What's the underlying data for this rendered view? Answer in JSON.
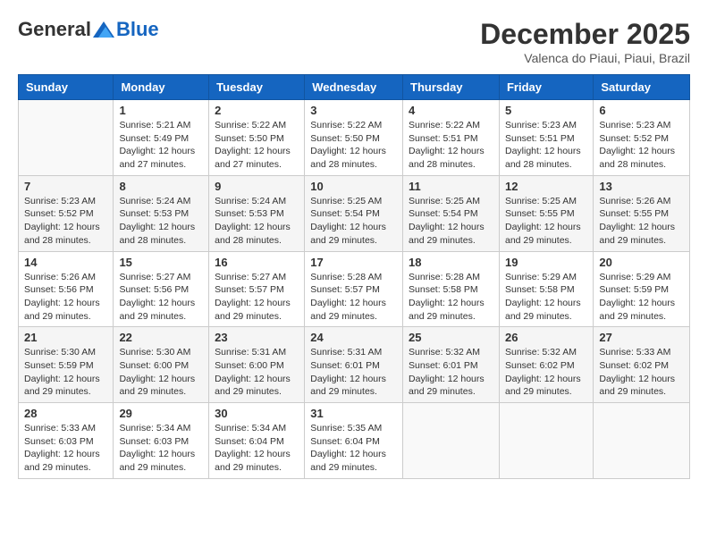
{
  "header": {
    "logo_general": "General",
    "logo_blue": "Blue",
    "month_title": "December 2025",
    "location": "Valenca do Piaui, Piaui, Brazil"
  },
  "weekdays": [
    "Sunday",
    "Monday",
    "Tuesday",
    "Wednesday",
    "Thursday",
    "Friday",
    "Saturday"
  ],
  "weeks": [
    [
      {
        "day": "",
        "info": ""
      },
      {
        "day": "1",
        "info": "Sunrise: 5:21 AM\nSunset: 5:49 PM\nDaylight: 12 hours\nand 27 minutes."
      },
      {
        "day": "2",
        "info": "Sunrise: 5:22 AM\nSunset: 5:50 PM\nDaylight: 12 hours\nand 27 minutes."
      },
      {
        "day": "3",
        "info": "Sunrise: 5:22 AM\nSunset: 5:50 PM\nDaylight: 12 hours\nand 28 minutes."
      },
      {
        "day": "4",
        "info": "Sunrise: 5:22 AM\nSunset: 5:51 PM\nDaylight: 12 hours\nand 28 minutes."
      },
      {
        "day": "5",
        "info": "Sunrise: 5:23 AM\nSunset: 5:51 PM\nDaylight: 12 hours\nand 28 minutes."
      },
      {
        "day": "6",
        "info": "Sunrise: 5:23 AM\nSunset: 5:52 PM\nDaylight: 12 hours\nand 28 minutes."
      }
    ],
    [
      {
        "day": "7",
        "info": "Sunrise: 5:23 AM\nSunset: 5:52 PM\nDaylight: 12 hours\nand 28 minutes."
      },
      {
        "day": "8",
        "info": "Sunrise: 5:24 AM\nSunset: 5:53 PM\nDaylight: 12 hours\nand 28 minutes."
      },
      {
        "day": "9",
        "info": "Sunrise: 5:24 AM\nSunset: 5:53 PM\nDaylight: 12 hours\nand 28 minutes."
      },
      {
        "day": "10",
        "info": "Sunrise: 5:25 AM\nSunset: 5:54 PM\nDaylight: 12 hours\nand 29 minutes."
      },
      {
        "day": "11",
        "info": "Sunrise: 5:25 AM\nSunset: 5:54 PM\nDaylight: 12 hours\nand 29 minutes."
      },
      {
        "day": "12",
        "info": "Sunrise: 5:25 AM\nSunset: 5:55 PM\nDaylight: 12 hours\nand 29 minutes."
      },
      {
        "day": "13",
        "info": "Sunrise: 5:26 AM\nSunset: 5:55 PM\nDaylight: 12 hours\nand 29 minutes."
      }
    ],
    [
      {
        "day": "14",
        "info": "Sunrise: 5:26 AM\nSunset: 5:56 PM\nDaylight: 12 hours\nand 29 minutes."
      },
      {
        "day": "15",
        "info": "Sunrise: 5:27 AM\nSunset: 5:56 PM\nDaylight: 12 hours\nand 29 minutes."
      },
      {
        "day": "16",
        "info": "Sunrise: 5:27 AM\nSunset: 5:57 PM\nDaylight: 12 hours\nand 29 minutes."
      },
      {
        "day": "17",
        "info": "Sunrise: 5:28 AM\nSunset: 5:57 PM\nDaylight: 12 hours\nand 29 minutes."
      },
      {
        "day": "18",
        "info": "Sunrise: 5:28 AM\nSunset: 5:58 PM\nDaylight: 12 hours\nand 29 minutes."
      },
      {
        "day": "19",
        "info": "Sunrise: 5:29 AM\nSunset: 5:58 PM\nDaylight: 12 hours\nand 29 minutes."
      },
      {
        "day": "20",
        "info": "Sunrise: 5:29 AM\nSunset: 5:59 PM\nDaylight: 12 hours\nand 29 minutes."
      }
    ],
    [
      {
        "day": "21",
        "info": "Sunrise: 5:30 AM\nSunset: 5:59 PM\nDaylight: 12 hours\nand 29 minutes."
      },
      {
        "day": "22",
        "info": "Sunrise: 5:30 AM\nSunset: 6:00 PM\nDaylight: 12 hours\nand 29 minutes."
      },
      {
        "day": "23",
        "info": "Sunrise: 5:31 AM\nSunset: 6:00 PM\nDaylight: 12 hours\nand 29 minutes."
      },
      {
        "day": "24",
        "info": "Sunrise: 5:31 AM\nSunset: 6:01 PM\nDaylight: 12 hours\nand 29 minutes."
      },
      {
        "day": "25",
        "info": "Sunrise: 5:32 AM\nSunset: 6:01 PM\nDaylight: 12 hours\nand 29 minutes."
      },
      {
        "day": "26",
        "info": "Sunrise: 5:32 AM\nSunset: 6:02 PM\nDaylight: 12 hours\nand 29 minutes."
      },
      {
        "day": "27",
        "info": "Sunrise: 5:33 AM\nSunset: 6:02 PM\nDaylight: 12 hours\nand 29 minutes."
      }
    ],
    [
      {
        "day": "28",
        "info": "Sunrise: 5:33 AM\nSunset: 6:03 PM\nDaylight: 12 hours\nand 29 minutes."
      },
      {
        "day": "29",
        "info": "Sunrise: 5:34 AM\nSunset: 6:03 PM\nDaylight: 12 hours\nand 29 minutes."
      },
      {
        "day": "30",
        "info": "Sunrise: 5:34 AM\nSunset: 6:04 PM\nDaylight: 12 hours\nand 29 minutes."
      },
      {
        "day": "31",
        "info": "Sunrise: 5:35 AM\nSunset: 6:04 PM\nDaylight: 12 hours\nand 29 minutes."
      },
      {
        "day": "",
        "info": ""
      },
      {
        "day": "",
        "info": ""
      },
      {
        "day": "",
        "info": ""
      }
    ]
  ]
}
